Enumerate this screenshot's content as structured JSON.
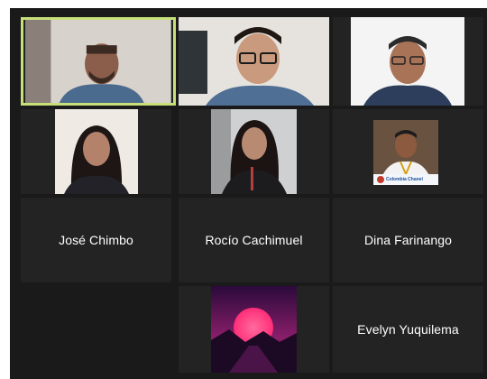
{
  "meeting": {
    "participants": [
      {
        "id": "p1",
        "name": "",
        "video": true,
        "active_speaker": true
      },
      {
        "id": "p2",
        "name": "",
        "video": true,
        "active_speaker": false
      },
      {
        "id": "p3",
        "name": "",
        "video": true,
        "active_speaker": false
      },
      {
        "id": "p4",
        "name": "",
        "video": true,
        "active_speaker": false
      },
      {
        "id": "p5",
        "name": "",
        "video": true,
        "active_speaker": false
      },
      {
        "id": "p6",
        "name": "",
        "video": true,
        "active_speaker": false
      },
      {
        "id": "p7",
        "name": "José Chimbo",
        "video": false
      },
      {
        "id": "p8",
        "name": "Rocío Cachimuel",
        "video": false
      },
      {
        "id": "p9",
        "name": "Dina Farinango",
        "video": false
      },
      {
        "id": "p10",
        "name": "",
        "video": true,
        "background": "sunset"
      },
      {
        "id": "p11",
        "name": "Evelyn Yuquilema",
        "video": false
      }
    ],
    "logo_text": "Colombia Chanel",
    "colors": {
      "grid_background": "#1a1a1a",
      "tile_background": "#232323",
      "active_speaker_border": "#c7e07a",
      "name_text": "#ffffff"
    }
  }
}
